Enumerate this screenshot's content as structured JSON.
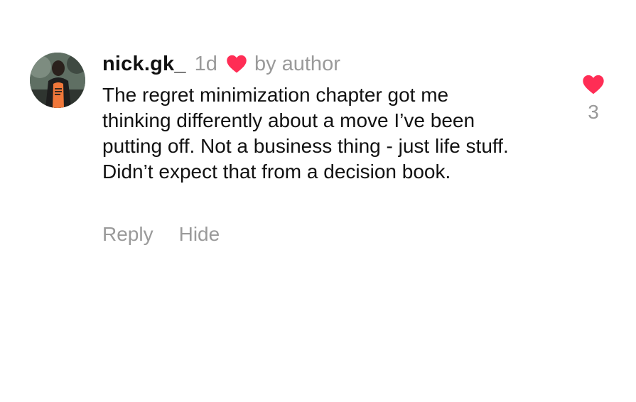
{
  "comment": {
    "username": "nick.gk_",
    "time": "1d",
    "liked_by_author_label": "by author",
    "text": "The regret minimization chapter got me thinking differently about a move I’ve been putting off. Not a business thing - just life stuff. Didn’t expect that from a decision book.",
    "like_count": "3",
    "actions": {
      "reply": "Reply",
      "hide": "Hide"
    },
    "icons": {
      "avatar": "user-photo",
      "liked_by_author": "heart-icon",
      "like": "heart-icon"
    }
  },
  "colors": {
    "heart": "#ff2d55",
    "muted_text": "#9a9a9a",
    "primary_text": "#111111"
  }
}
